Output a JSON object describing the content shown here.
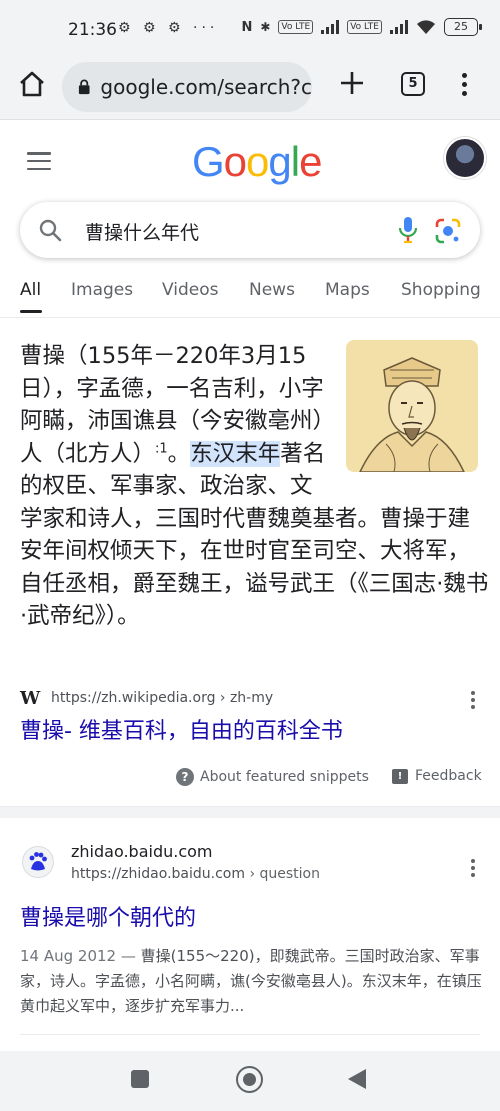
{
  "status_bar": {
    "time": "21:36",
    "left_icons": "⚙ ⚙ ⚙  ···",
    "nfc": "N",
    "bluetooth": "✱",
    "volte1": "Vo LTE",
    "volte2": "Vo LTE",
    "battery": "25"
  },
  "browser": {
    "url": "google.com/search?c",
    "tab_count": "5"
  },
  "google": {
    "logo_letters": [
      {
        "char": "G",
        "color": "#4285F4"
      },
      {
        "char": "o",
        "color": "#EA4335"
      },
      {
        "char": "o",
        "color": "#FBBC05"
      },
      {
        "char": "g",
        "color": "#4285F4"
      },
      {
        "char": "l",
        "color": "#34A853"
      },
      {
        "char": "e",
        "color": "#EA4335"
      }
    ],
    "query": "曹操什么年代"
  },
  "tabs": {
    "all": "All",
    "images": "Images",
    "videos": "Videos",
    "news": "News",
    "maps": "Maps",
    "shopping": "Shopping"
  },
  "snippet": {
    "part1": "曹操（155年－220年3月15日），字孟德，一名吉利，小字阿瞞，沛国谯县（今安徽亳州）人（北方人）",
    "sup": ":1",
    "part2": "。",
    "highlight": "东汉末年",
    "part3": "著名的权臣、军事家、政治家、文学家和诗人，三国时代曹魏奠基者。曹操于建安年间权倾天下，在世时官至司空、大将军，自任丞相，爵至魏王，谥号武王（《三国志·魏书·武帝纪》）。",
    "source_logo": "W",
    "source_url": "https://zh.wikipedia.org › zh-my",
    "title": "曹操- 维基百科，自由的百科全书",
    "about": "About featured snippets",
    "feedback": "Feedback"
  },
  "result2": {
    "site": "zhidao.baidu.com",
    "url": "https://zhidao.baidu.com",
    "crumb": " › question",
    "title": "曹操是哪个朝代的",
    "date": "14 Aug 2012 — ",
    "snippet": "曹操(155～220)，即魏武帝。三国时政治家、军事家，诗人。字孟德，小名阿瞒，谯(今安徽亳县人)。东汉末年，在镇压黄巾起义军中，逐步扩充军事力..."
  },
  "colors": {
    "link": "#1a0dab",
    "highlight": "#d2e3fc",
    "chrome_bg": "#f1f3f4"
  }
}
